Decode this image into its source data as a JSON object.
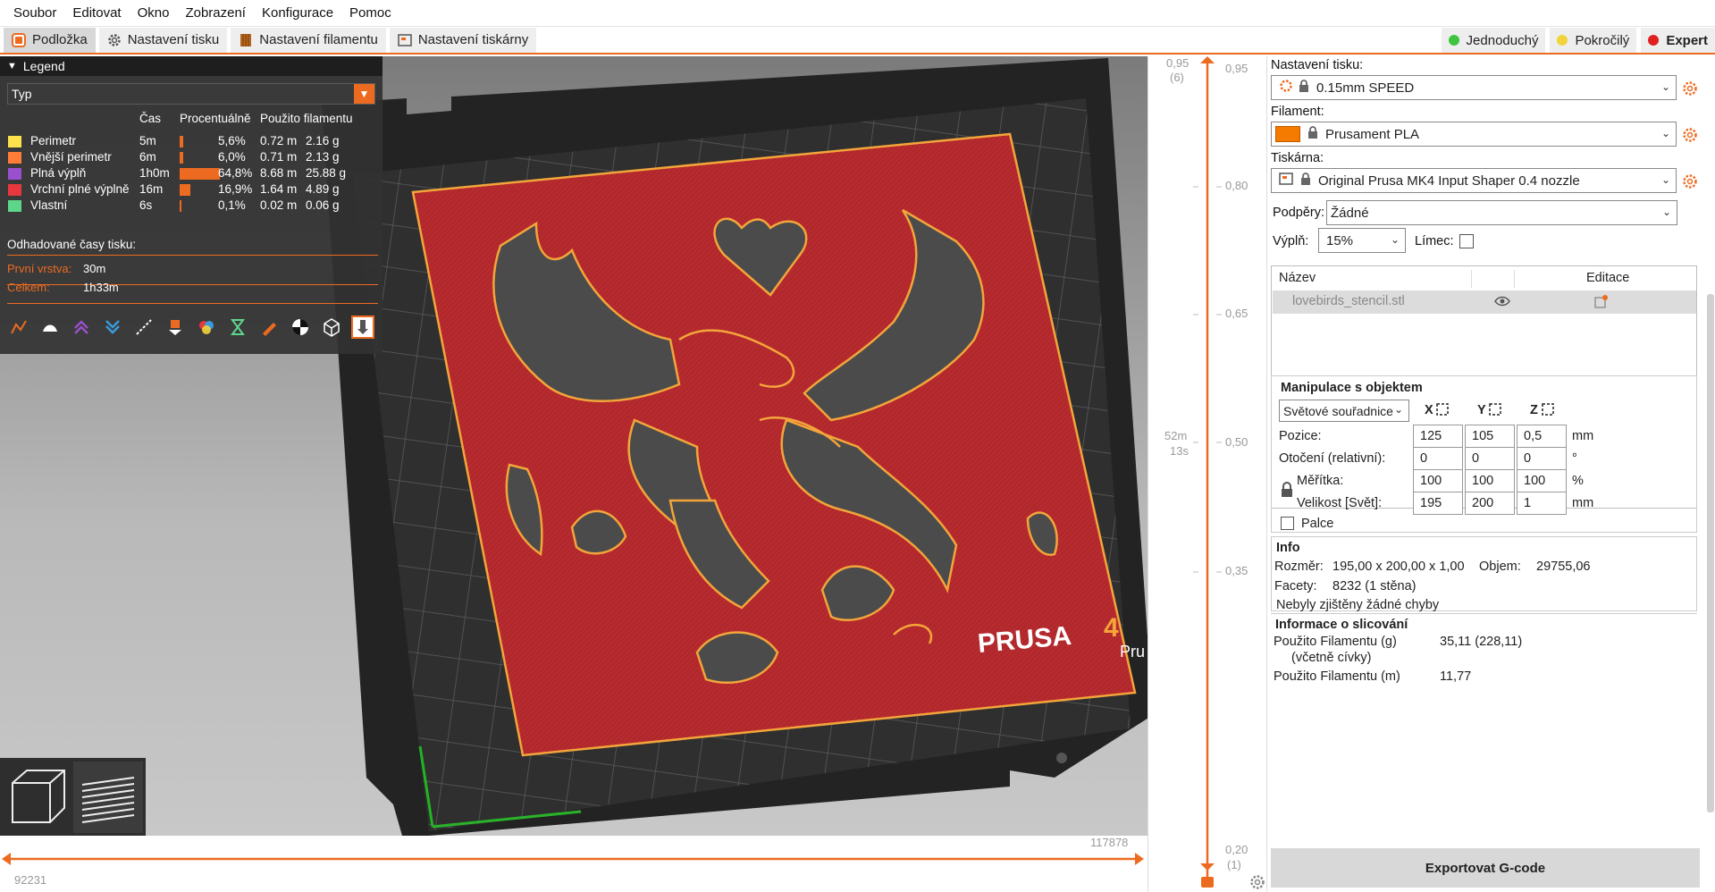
{
  "menu": [
    "Soubor",
    "Editovat",
    "Okno",
    "Zobrazení",
    "Konfigurace",
    "Pomoc"
  ],
  "tabs": [
    {
      "label": "Podložka",
      "active": true,
      "icon": "plater-icon"
    },
    {
      "label": "Nastavení tisku",
      "active": false,
      "icon": "gear-icon"
    },
    {
      "label": "Nastavení filamentu",
      "active": false,
      "icon": "spool-icon"
    },
    {
      "label": "Nastavení tiskárny",
      "active": false,
      "icon": "printer-icon"
    }
  ],
  "modes": [
    {
      "label": "Jednoduchý",
      "color": "#3ec43e",
      "active": false
    },
    {
      "label": "Pokročilý",
      "color": "#f2d43a",
      "active": false
    },
    {
      "label": "Expert",
      "color": "#e02020",
      "active": true
    }
  ],
  "legend": {
    "title": "Legend",
    "type_select": "Typ",
    "columns": {
      "time": "Čas",
      "percent": "Procentuálně",
      "filament": "Použito filamentu"
    },
    "rows": [
      {
        "name": "Perimetr",
        "color": "#ffe14d",
        "time": "5m",
        "percent": "5,6%",
        "pct_value": 5.6,
        "length": "0.72 m",
        "weight": "2.16 g"
      },
      {
        "name": "Vnější perimetr",
        "color": "#ff7d38",
        "time": "6m",
        "percent": "6,0%",
        "pct_value": 6.0,
        "length": "0.71 m",
        "weight": "2.13 g"
      },
      {
        "name": "Plná výplň",
        "color": "#9a4fcf",
        "time": "1h0m",
        "percent": "64,8%",
        "pct_value": 64.8,
        "length": "8.68 m",
        "weight": "25.88 g"
      },
      {
        "name": "Vrchní plné výplně",
        "color": "#e8383d",
        "time": "16m",
        "percent": "16,9%",
        "pct_value": 16.9,
        "length": "1.64 m",
        "weight": "4.89 g"
      },
      {
        "name": "Vlastní",
        "color": "#5ed68a",
        "time": "6s",
        "percent": "0,1%",
        "pct_value": 0.1,
        "length": "0.02 m",
        "weight": "0.06 g"
      }
    ],
    "est_title": "Odhadované časy tisku:",
    "first_layer_label": "První vrstva:",
    "first_layer_value": "30m",
    "total_label": "Celkem:",
    "total_value": "1h33m",
    "tools": [
      "travel-icon",
      "wipe-icon",
      "retraction-icon",
      "deretraction-icon",
      "seams-icon",
      "tool-change-icon",
      "color-change-icon",
      "pause-icon",
      "custom-gcode-icon",
      "center-of-gravity-icon",
      "shells-icon",
      "tool-marker-icon"
    ]
  },
  "viewport": {
    "printer_text": "PRUSA",
    "printer_text_suffix": "4",
    "printer_text2": "Pru",
    "h_slider_right": "117878",
    "h_slider_left": "92231",
    "v_slider": {
      "top_value": "0,95",
      "top_layer": "(6)",
      "top_right": "0,95",
      "bottom_value": "0,20",
      "bottom_layer": "(1)",
      "ticks": [
        "0,80",
        "0,65",
        "0,50",
        "0,35"
      ],
      "time_label": "52m",
      "time_label2": "13s"
    }
  },
  "right_panel": {
    "print_settings_label": "Nastavení tisku:",
    "print_settings_value": "0.15mm SPEED",
    "filament_label": "Filament:",
    "filament_value": "Prusament PLA",
    "filament_color": "#f47b00",
    "printer_label": "Tiskárna:",
    "printer_value": "Original Prusa MK4 Input Shaper 0.4 nozzle",
    "supports_label": "Podpěry:",
    "supports_value": "Žádné",
    "infill_label": "Výplň:",
    "infill_value": "15%",
    "brim_label": "Límec:",
    "object_list": {
      "col_name": "Název",
      "col_edit": "Editace",
      "items": [
        {
          "name": "lovebirds_stencil.stl"
        }
      ]
    },
    "manipulation": {
      "title": "Manipulace s objektem",
      "coord_select": "Světové souřadnice",
      "axes": [
        "X",
        "Y",
        "Z"
      ],
      "rows": [
        {
          "label": "Pozice:",
          "values": [
            "125",
            "105",
            "0,5"
          ],
          "unit": "mm"
        },
        {
          "label": "Otočení (relativní):",
          "values": [
            "0",
            "0",
            "0"
          ],
          "unit": "°"
        },
        {
          "label": "Měřítka:",
          "values": [
            "100",
            "100",
            "100"
          ],
          "unit": "%"
        },
        {
          "label": "Velikost [Svět]:",
          "values": [
            "195",
            "200",
            "1"
          ],
          "unit": "mm"
        }
      ],
      "inches_label": "Palce"
    },
    "info": {
      "title": "Info",
      "size_label": "Rozměr:",
      "size_value": "195,00 x 200,00 x 1,00",
      "volume_label": "Objem:",
      "volume_value": "29755,06",
      "facets_label": "Facety:",
      "facets_value": "8232 (1 stěna)",
      "errors": "Nebyly zjištěny žádné chyby"
    },
    "slice_info": {
      "title": "Informace o slicování",
      "used_g_label": "Použito Filamentu (g)",
      "used_g_label2": "(včetně cívky)",
      "used_g_value": "35,11 (228,11)",
      "used_m_label": "Použito Filamentu (m)",
      "used_m_value": "11,77"
    },
    "export_button": "Exportovat G-code"
  }
}
